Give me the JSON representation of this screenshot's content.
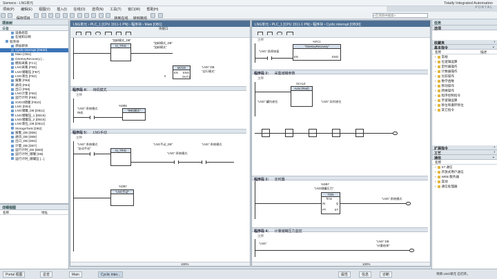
{
  "window": {
    "title": "Siemens  -  LNG单元",
    "brand_line1": "Totally Integrated Automation",
    "brand_line2": "PORTAL"
  },
  "menu": [
    "项目(P)",
    "编辑(E)",
    "视图(V)",
    "插入(I)",
    "在线(O)",
    "选项(N)",
    "工具(T)",
    "窗口(W)",
    "帮助(H)"
  ],
  "toolbar": {
    "save_label": "保存项目",
    "online_label": "转到在线",
    "offline_label": "转到离线",
    "search_placeholder": "<在项目中搜索>"
  },
  "project_tree": {
    "header": "项目树",
    "subheader": "设备",
    "items": [
      {
        "label": "设备组态",
        "indent": 2
      },
      {
        "label": "在线和诊断",
        "indent": 2
      },
      {
        "label": "程序块",
        "indent": 1
      },
      {
        "label": "添加新块",
        "indent": 2
      },
      {
        "label": "Cyclic interrupt [OB30]",
        "indent": 2,
        "selected": true
      },
      {
        "label": "Main [OB1]",
        "indent": 2
      },
      {
        "label": "OneKeyRecovery [...",
        "indent": 2
      },
      {
        "label": "模拟采集 [FC1]",
        "indent": 2
      },
      {
        "label": "LNG采集 [FB6]",
        "indent": 2
      },
      {
        "label": "LNG储罐压 [FB7]",
        "indent": 2
      },
      {
        "label": "LNG液位 [FB2]",
        "indent": 2
      },
      {
        "label": "报警 [FB8]",
        "indent": 2
      },
      {
        "label": "通讯 [FB4]",
        "indent": 2
      },
      {
        "label": "出口 [FB5]",
        "indent": 2
      },
      {
        "label": "LNG计量 [FB3]",
        "indent": 2
      },
      {
        "label": "运行计时 [FB9]",
        "indent": 2
      },
      {
        "label": "SVDO储罐 [FB10]",
        "indent": 2
      },
      {
        "label": "LNG [DB4]",
        "indent": 2
      },
      {
        "label": "LNG储罐_DB [DB11]",
        "indent": 2
      },
      {
        "label": "LNG储罐压_1 [DB16]",
        "indent": 2
      },
      {
        "label": "LNG储罐压_2 [DB15]",
        "indent": 2
      },
      {
        "label": "LNG液位_DB [DB12]",
        "indent": 2
      },
      {
        "label": "StorageTank [DB2]",
        "indent": 2
      },
      {
        "label": "报警_DB [DB6]",
        "indent": 2
      },
      {
        "label": "通讯_DB [DB8]",
        "indent": 2
      },
      {
        "label": "出口_DB [DB3]",
        "indent": 2
      },
      {
        "label": "计量_DB [DB7]",
        "indent": 2
      },
      {
        "label": "运行计时_DB [DB9]",
        "indent": 2
      },
      {
        "label": "运行计时_储罐 [DB]",
        "indent": 2
      },
      {
        "label": "运行计时_储罐压 [...]",
        "indent": 2
      }
    ]
  },
  "details": {
    "header": "详细视图",
    "col1": "名称",
    "col2": "地址"
  },
  "left_editor": {
    "breadcrumb": "LNG单元  ›  PLC_1 [CPU 1511-1 PN]  ›  程序块  ›  Main [OB1]",
    "block_iface_label": "块接口",
    "zoom": "100%",
    "net1": {
      "fb_title": "SI_TRIG",
      "fb_label": "\"加卸模式_DB\"",
      "lbl1": "\"加卸模式_DB\"",
      "lbl2": "\"加卸模式\"",
      "move_title": "MOVE",
      "move_in": "0",
      "move_en": "EN",
      "move_out": "OUT1",
      "move_eno": "ENO",
      "tag_out": "\"LNG\".DB",
      "tag_out2": "\"运行模式\""
    },
    "net4": {
      "header": "程序段 4：",
      "title": "待机模式",
      "comment": "注释",
      "fb_title": "%DB5",
      "fb_name": "\"待机模式\"",
      "tag_in": "\"LNG\".系统模式",
      "tag_in2": "待机"
    },
    "net5": {
      "header": "程序段 5：",
      "title": "LNG手动",
      "comment": "注释",
      "fb1_title": "SI_TRIG",
      "tag1": "\"LNG\".系统模式",
      "tag1b": "\"自动手动\"",
      "lbl1": "\"LNG手动_DB\"",
      "lbl2": "\"LNG\".系统模式",
      "lbl3": "\"LNG\".系统模式",
      "fb2_title": "%DB7",
      "fb2_name": "\"LNG手动\""
    }
  },
  "right_editor": {
    "breadcrumb": "LNG单元  ›  PLC_1 [CPU 1511-1 PN]  ›  程序块  ›  Cyclic interrupt [OB30]",
    "zoom": "100%",
    "net1": {
      "comment": "注释",
      "tag_in": "\"LNG\".急停恢复",
      "fb_title": "%FC1",
      "fb_name": "\"OneKeyRecovery\"",
      "fb_en": "EN",
      "fb_eno": "ENO"
    },
    "net2": {
      "header": "程序段 2：",
      "title": "采集储罐参数",
      "comment": "注释",
      "fb_title": "SCALE",
      "fb_sub": "Auto (Real)",
      "tag_in": "\"LNG\".罐内液位",
      "tag_out": "\"LNG\".实时液位"
    },
    "net3": {
      "header": "程序段 3：",
      "title": "定时器",
      "comment": "注释",
      "fb_title": "%DB7",
      "fb_name": "\"LNG储罐压力\"",
      "timer": "TON",
      "timer_sub": "Time",
      "timer_in": "IN",
      "timer_q": "Q",
      "timer_pt": "PT",
      "timer_et": "ET",
      "tag_out": "\"LNG\".系统模式"
    },
    "net4": {
      "header": "程序段 4：",
      "title": "计量储罐压力监控",
      "comment": "注释",
      "tag1": "\"LNG\"",
      "tag2": "\"LNG\".DB",
      "tag3": "\"计量结束\""
    }
  },
  "tasks": {
    "header": "任务",
    "options_label": "选项",
    "fav_label": "收藏夹",
    "basic_label": "基本指令",
    "col_name": "名称",
    "col_desc": "描述",
    "basic_items": [
      "常规",
      "位逻辑运算",
      "定时器操作",
      "计数器操作",
      "比较操作",
      "数学函数",
      "移动操作",
      "转换操作",
      "程序控制指令",
      "字逻辑运算",
      "移位和循环移位",
      "其它指令"
    ],
    "ext_label": "扩展指令",
    "tech_label": "工艺",
    "comm_label": "通信",
    "comm_col_name": "名称",
    "comm_items": [
      "S7 通信",
      "开放式用户通信",
      "WEB 服务器",
      "其他",
      "通信处理器"
    ]
  },
  "status_bar": {
    "portal_label": "Portal 视图",
    "tab1": "总览",
    "tab2": "Main",
    "tab3": "Cyclic inter...",
    "props": "属性",
    "info": "信息",
    "diag": "诊断",
    "status_text": "项目 LNG单元 已打开。"
  },
  "colors": {
    "accent": "#4d6f93",
    "selected": "#3a74b8",
    "panel": "#dde4ea"
  }
}
